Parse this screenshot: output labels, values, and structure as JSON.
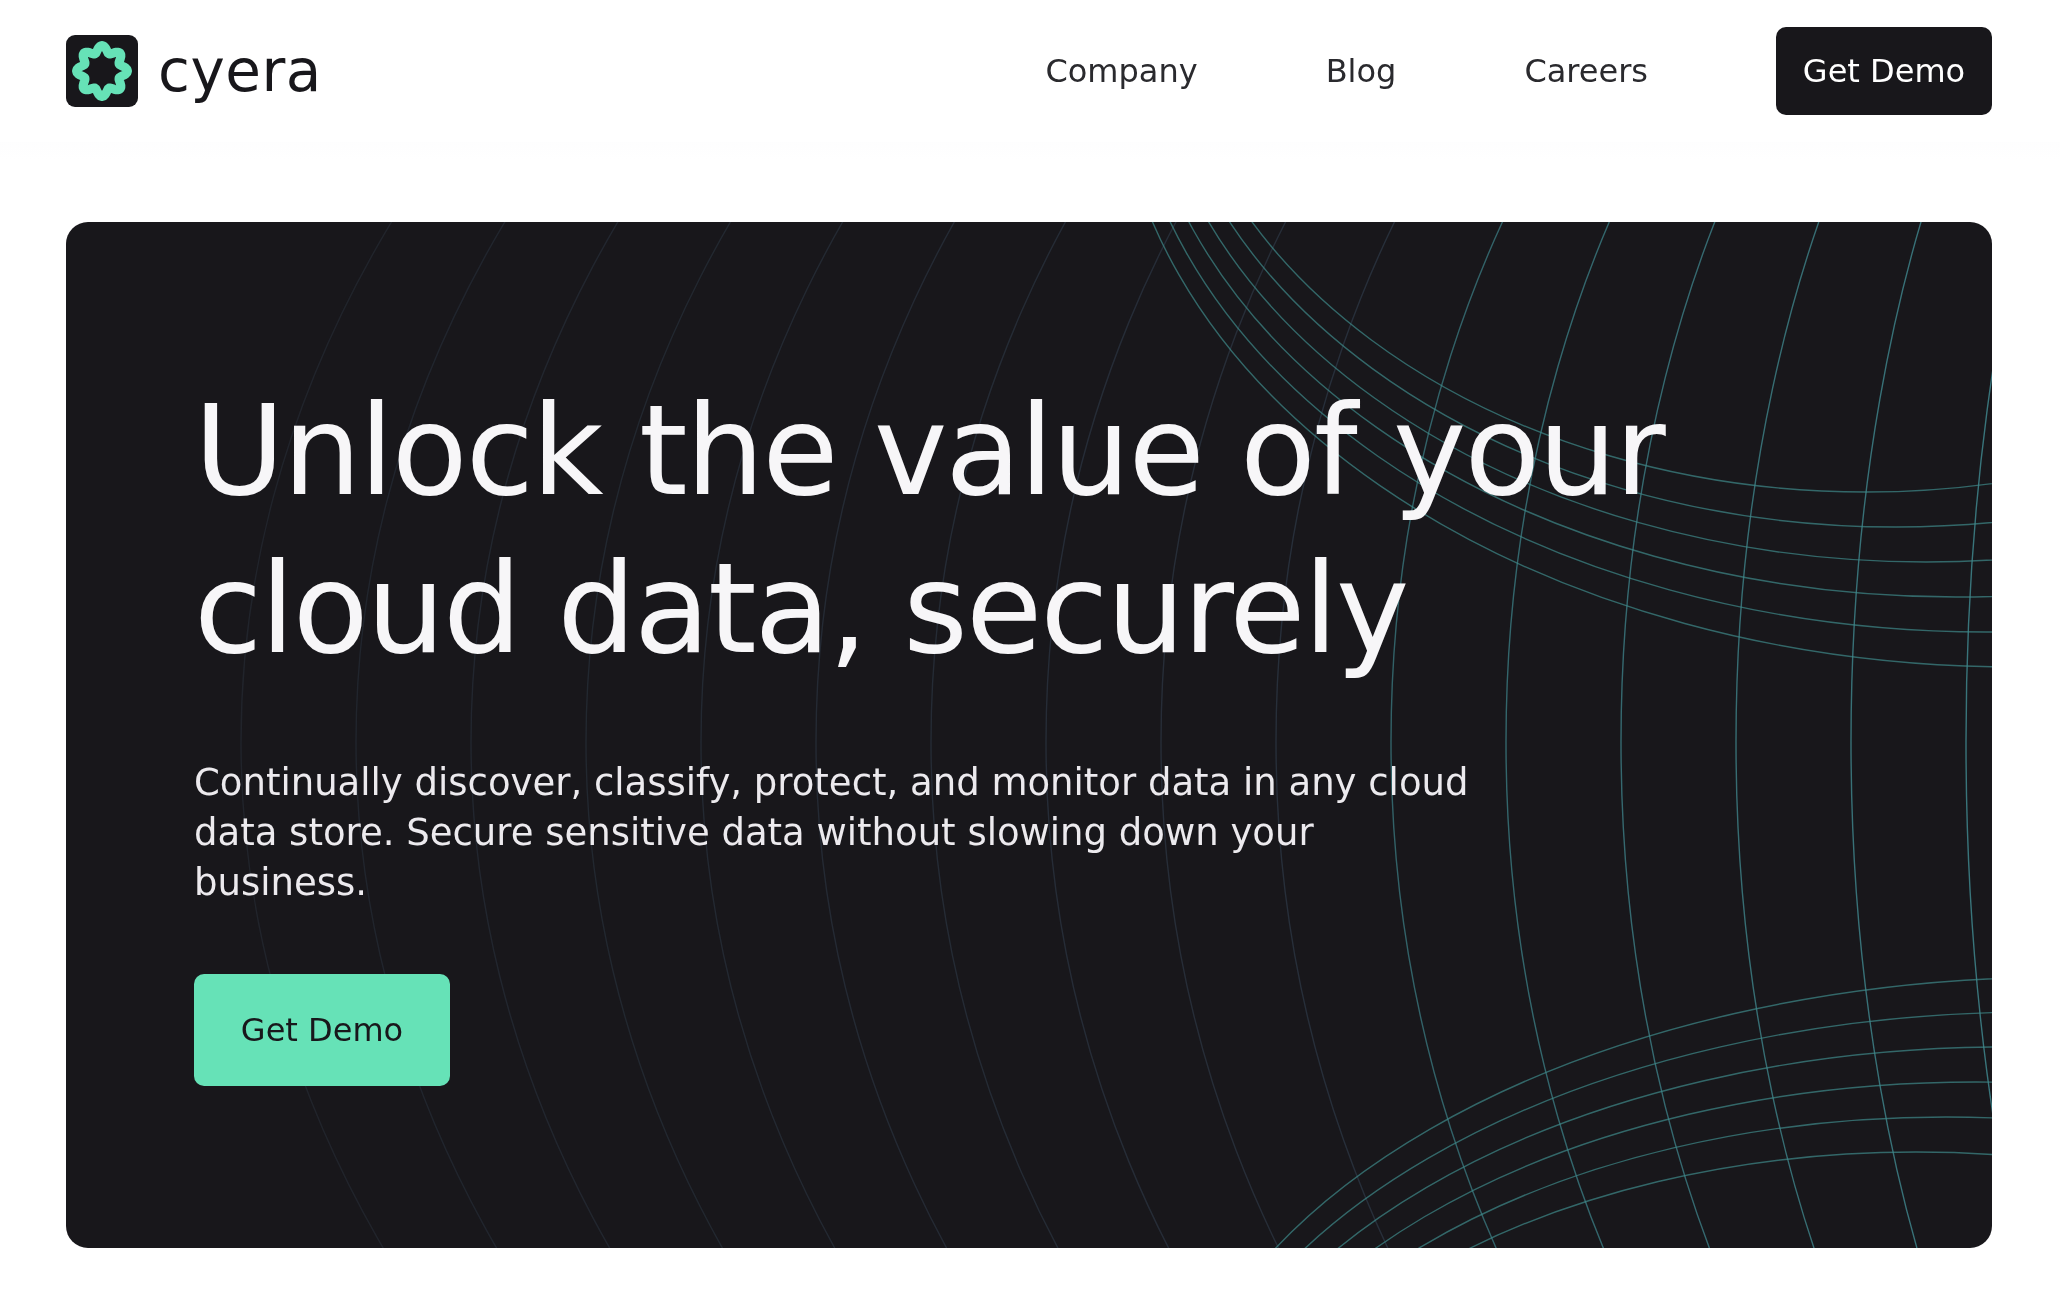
{
  "brand": {
    "name": "cyera"
  },
  "nav": {
    "links": [
      "Company",
      "Blog",
      "Careers"
    ],
    "cta": "Get Demo"
  },
  "hero": {
    "title": "Unlock the value of your cloud data, securely",
    "subtitle": "Continually discover, classify, protect, and monitor data in any cloud data store. Secure sensitive data without slowing down your business.",
    "cta": "Get Demo"
  }
}
